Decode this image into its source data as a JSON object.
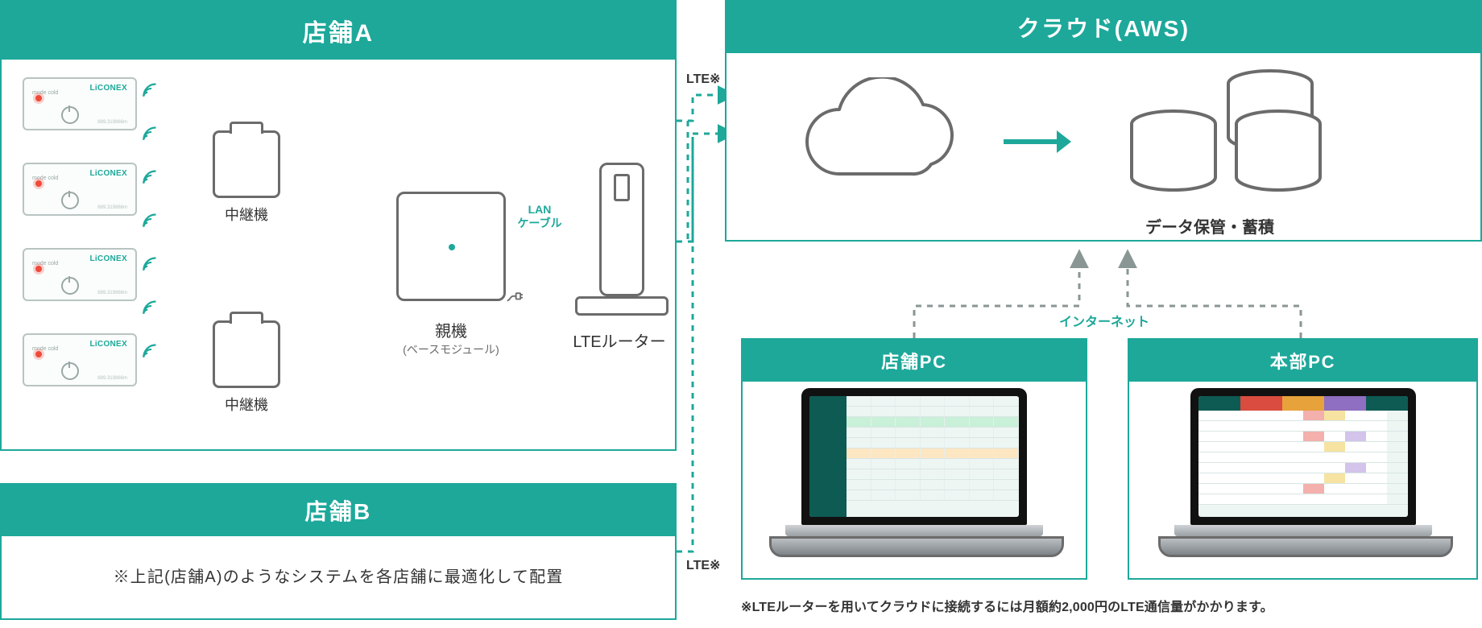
{
  "colors": {
    "accent": "#1da89a"
  },
  "store_a": {
    "title": "店舗A",
    "sensor_brand": "LiCONEX",
    "sensor_mode_labels": "mode\ncold",
    "sensor_ms": "889.319866m",
    "repeater_label": "中継機",
    "base_label": "親機",
    "base_sub": "(ベースモジュール)",
    "lan_label_a": "LAN",
    "lan_label_b": "ケーブル",
    "router_label": "LTEルーター"
  },
  "store_b": {
    "title": "店舗B",
    "desc": "※上記(店舗A)のようなシステムを各店舗に最適化して配置"
  },
  "links": {
    "lte_a": "LTE※",
    "lte_b": "LTE※",
    "internet": "インターネット"
  },
  "cloud": {
    "title": "クラウド(AWS)",
    "storage_label": "データ保管・蓄積"
  },
  "store_pc": {
    "title": "店舗PC"
  },
  "hq_pc": {
    "title": "本部PC"
  },
  "footnote": "※LTEルーターを用いてクラウドに接続するには月額約2,000円のLTE通信量がかかります。"
}
